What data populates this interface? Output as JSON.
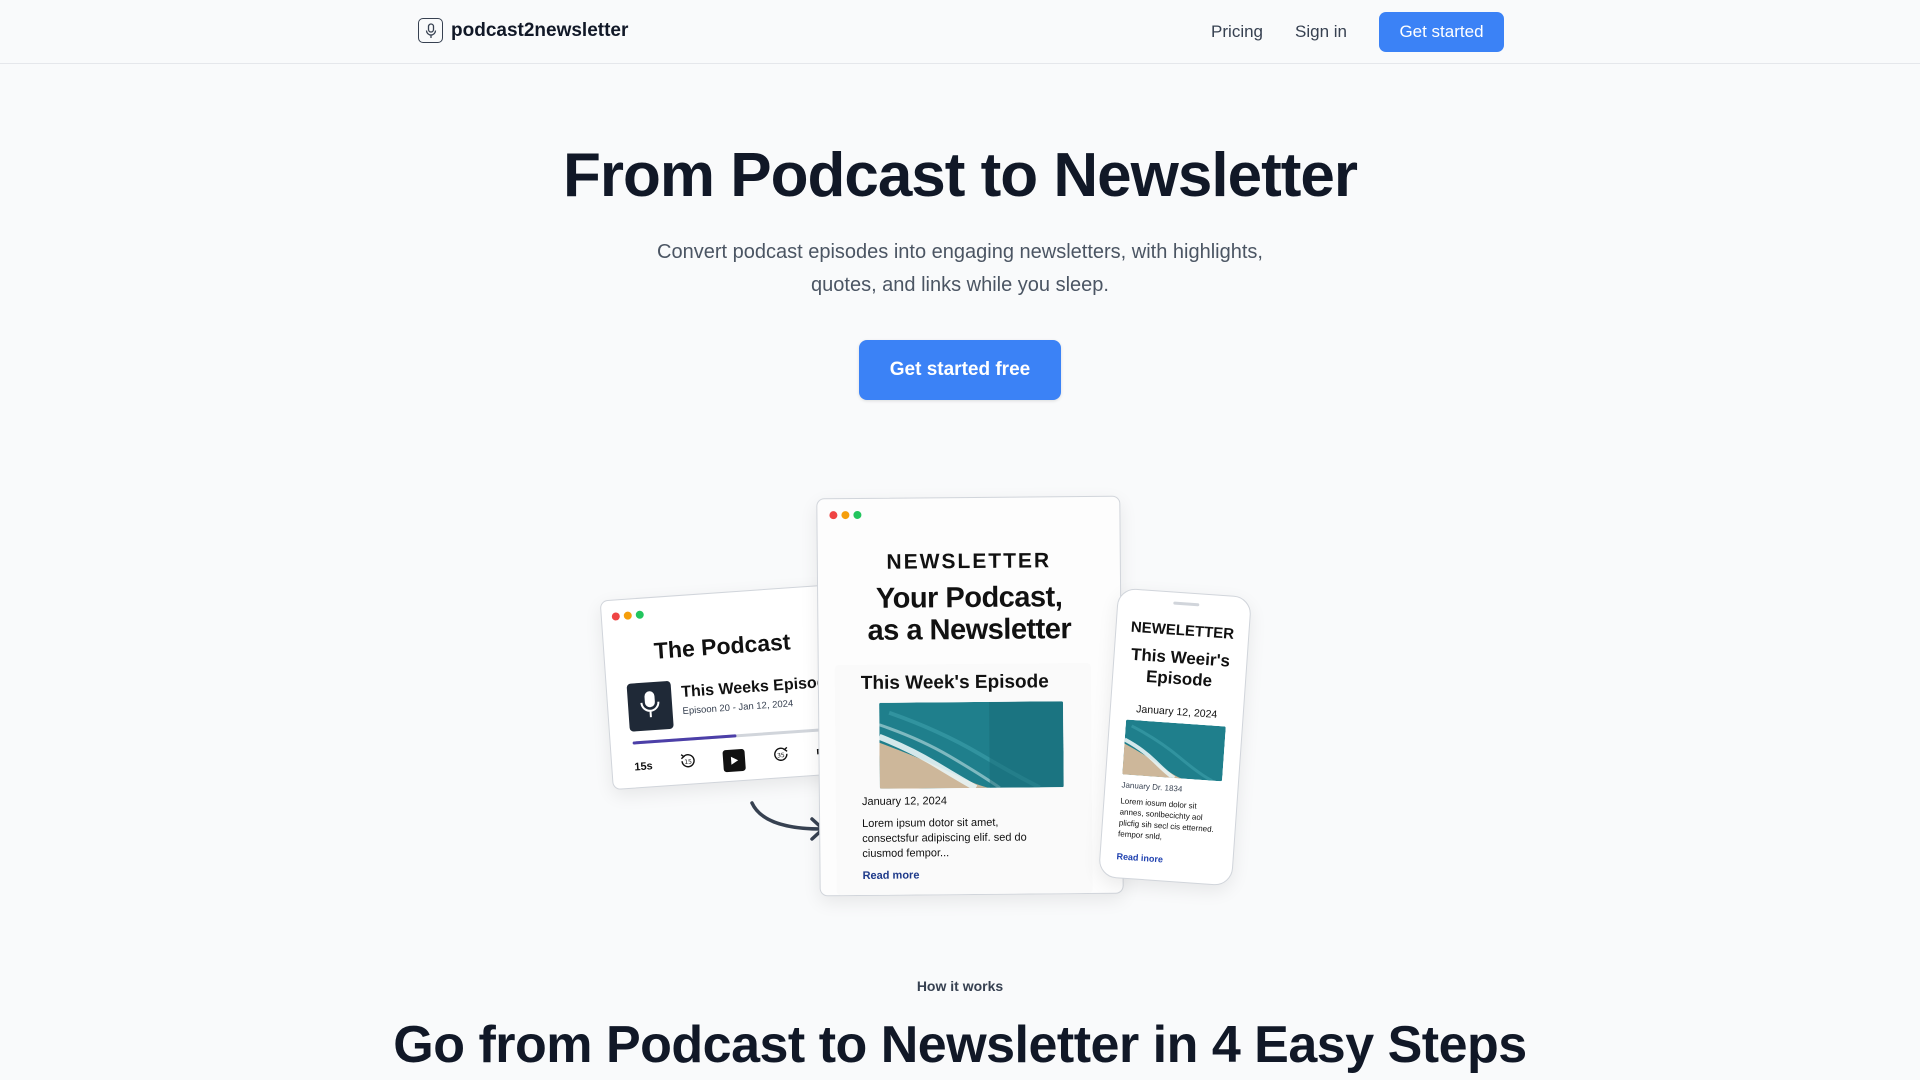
{
  "nav": {
    "brand": "podcast2newsletter",
    "links": [
      "Pricing",
      "Sign in"
    ],
    "cta": "Get started"
  },
  "hero": {
    "title": "From Podcast to Newsletter",
    "subtitle_line1": "Convert podcast episodes into engaging newsletters, with highlights,",
    "subtitle_line2": "quotes, and links while you sleep.",
    "cta": "Get started free"
  },
  "illustration": {
    "podcast": {
      "title": "The Podcast",
      "episode_title": "This Weeks Episode",
      "episode_meta": "Episoon 20 - Jan 12, 2024",
      "skip_label": "15s",
      "rewind_label": "15",
      "forward_label": "35",
      "progress": 0.52
    },
    "newsletter": {
      "kicker": "NEWSLETTER",
      "heading_line1": "Your Podcast,",
      "heading_line2": "as a Newsletter",
      "episode": "This Week's Episode",
      "date": "January 12, 2024",
      "body": "Lorem ipsum dotor sit amet, consectsfur adipiscing elif. sed do ciusmod fempor...",
      "read_more": "Read more"
    },
    "phone": {
      "kicker": "NEWELETTER",
      "heading_line1": "This Weeir's",
      "heading_line2": "Episode",
      "date": "January 12, 2024",
      "sub": "January Dr. 1834",
      "body": "Lorem iosum dolor sit annes, sonlbecichty aol plicfig sih secl cis etterned. fempor snld,",
      "read_more": "Read inore"
    },
    "colors": {
      "window_dot_red": "#ef4444",
      "window_dot_amber": "#f59e0b",
      "window_dot_green": "#22c55e",
      "progress": "#4c3fa8",
      "ocean": "#1f7f8c",
      "sand": "#cdb79a"
    }
  },
  "how": {
    "label": "How it works",
    "title": "Go from Podcast to Newsletter in 4 Easy Steps"
  },
  "colors": {
    "primary": "#3b82f6",
    "background": "#f9fafb",
    "text": "#111827",
    "muted": "#4b5563"
  },
  "icons": {
    "brand": "microphone-icon",
    "podcast_cover": "microphone-icon",
    "rewind": "rewind-icon",
    "play": "play-icon",
    "forward": "forward-icon",
    "volume": "volume-icon",
    "arrow": "curved-arrow-icon"
  }
}
